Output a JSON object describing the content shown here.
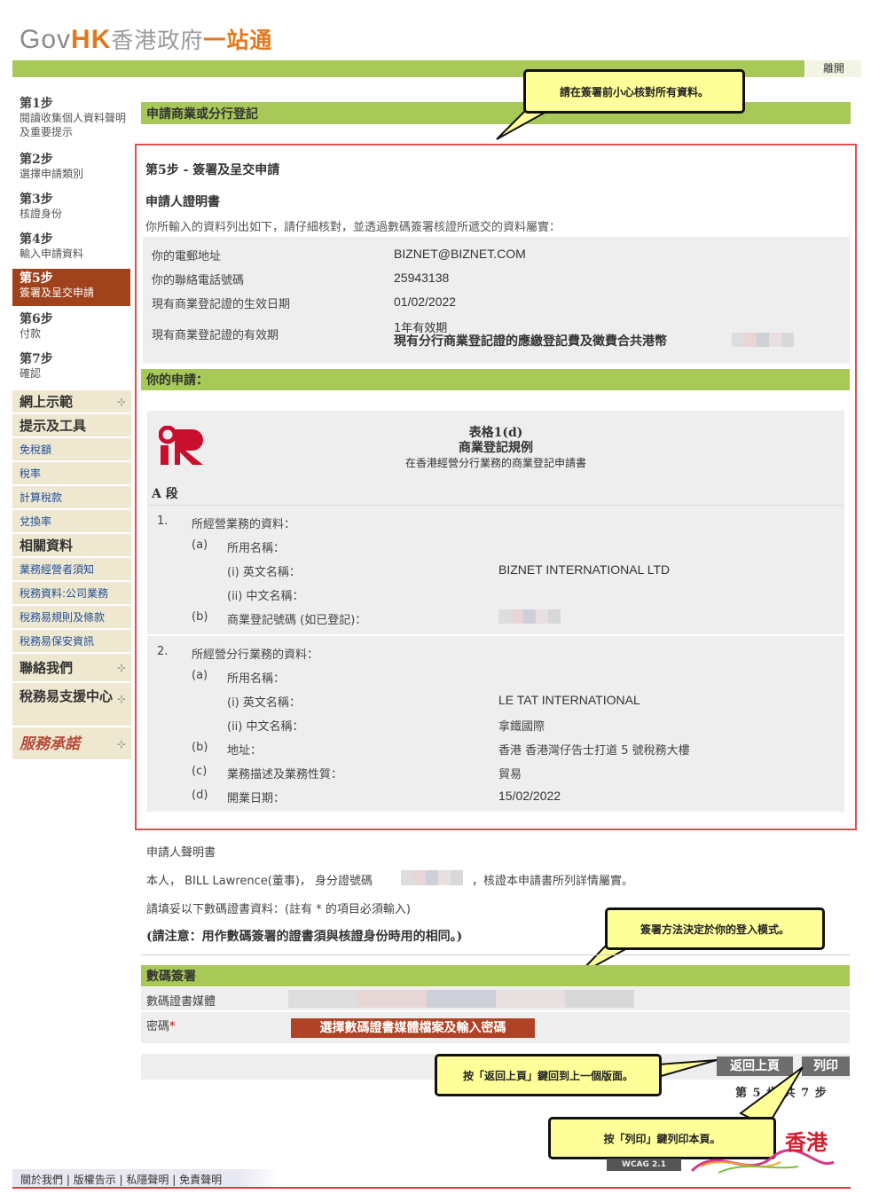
{
  "header": {
    "logo_gov": "Gov",
    "logo_hk": "HK",
    "logo_cn1": "香港政府",
    "logo_cn2": "一站通",
    "logout": "離開"
  },
  "sidebar": {
    "steps": [
      {
        "num": "第1步",
        "desc": "閱讀收集個人資料聲明及重要提示"
      },
      {
        "num": "第2步",
        "desc": "選擇申請類別"
      },
      {
        "num": "第3步",
        "desc": "核證身份"
      },
      {
        "num": "第4步",
        "desc": "輸入申請資料"
      },
      {
        "num": "第5步",
        "desc": "簽署及呈交申請"
      },
      {
        "num": "第6步",
        "desc": "付款"
      },
      {
        "num": "第7步",
        "desc": "確認"
      }
    ],
    "menu": [
      "網上示範",
      "提示及工具",
      "免稅額",
      "稅率",
      "計算稅款",
      "兌換率",
      "相關資料",
      "業務經營者須知",
      "稅務資料:公司業務",
      "稅務易規則及條款",
      "稅務易保安資訊",
      "聯絡我們",
      "稅務易支援中心",
      "服務承諾"
    ]
  },
  "main": {
    "section_title": "申請商業或分行登記",
    "step_title": "第5步 - 簽署及呈交申請",
    "declaration_title": "申請人證明書",
    "declaration_intro": "你所輸入的資料列出如下，請仔細核對，並透過數碼簽署核證所遞交的資料屬實：",
    "info": [
      {
        "label": "你的電郵地址",
        "value": "BIZNET@BIZNET.COM"
      },
      {
        "label": "你的聯絡電話號碼",
        "value": "25943138"
      },
      {
        "label": "現有商業登記證的生效日期",
        "value": "01/02/2022"
      },
      {
        "label": "現有商業登記證的有效期",
        "value": "1年有效期"
      }
    ],
    "fee_text": "現有分行商業登記證的應繳登記費及徵費合共港幣",
    "your_application": "你的申請：",
    "form": {
      "title": "表格1(d)",
      "subtitle": "商業登記規例",
      "desc": "在香港經營分行業務的商業登記申請書",
      "part": "A 段",
      "s1": "所經營業務的資料：",
      "s1a": "所用名稱：",
      "s1ai": "(i) 英文名稱：",
      "s1ai_v": "BIZNET INTERNATIONAL LTD",
      "s1aii": "(ii) 中文名稱：",
      "s1b": "商業登記號碼 (如已登記)：",
      "s2": "所經營分行業務的資料：",
      "s2a": "所用名稱：",
      "s2ai": "(i) 英文名稱：",
      "s2ai_v": "LE TAT INTERNATIONAL",
      "s2aii": "(ii) 中文名稱：",
      "s2aii_v": "拿鐵國際",
      "s2b": "地址：",
      "s2b_v": "香港 香港灣仔告士打道 5 號稅務大樓",
      "s2c": "業務描述及業務性質：",
      "s2c_v": "貿易",
      "s2d": "開業日期：",
      "s2d_v": "15/02/2022",
      "n1": "1.",
      "n2": "2.",
      "a": "(a)",
      "b": "(b)",
      "c": "(c)",
      "d": "(d)"
    },
    "statement_title": "申請人聲明書",
    "statement_pre": "本人， BILL Lawrence(董事)， 身分證號碼",
    "statement_post": "，核證本申請書所列詳情屬實。",
    "fill_note": "請填妥以下數碼證書資料：(註有 * 的項目必須輸入)",
    "attention": "(請注意：用作數碼簽署的證書須與核證身份時用的相同。)",
    "digital_sign": "數碼簽署",
    "cert_media": "數碼證書媒體",
    "password": "密碼",
    "required_star": "*",
    "select_cert_btn": "選擇數碼證書媒體檔案及輸入密碼",
    "back_btn": "返回上頁",
    "print_btn": "列印",
    "page_indicator": "第 5 步 共 7 步"
  },
  "callouts": {
    "c1": "請在簽署前小心核對所有資料。",
    "c2": "簽署方法決定於你的登入模式。",
    "c3": "按「返回上頁」鍵回到上一個版面。",
    "c4": "按「列印」鍵列印本頁。"
  },
  "footer": {
    "about": "關於我們",
    "copyright": "版權告示",
    "privacy": "私隱聲明",
    "disclaimer": "免責聲明",
    "hk_brand": "香港",
    "wcag": "WCAG 2.1"
  }
}
